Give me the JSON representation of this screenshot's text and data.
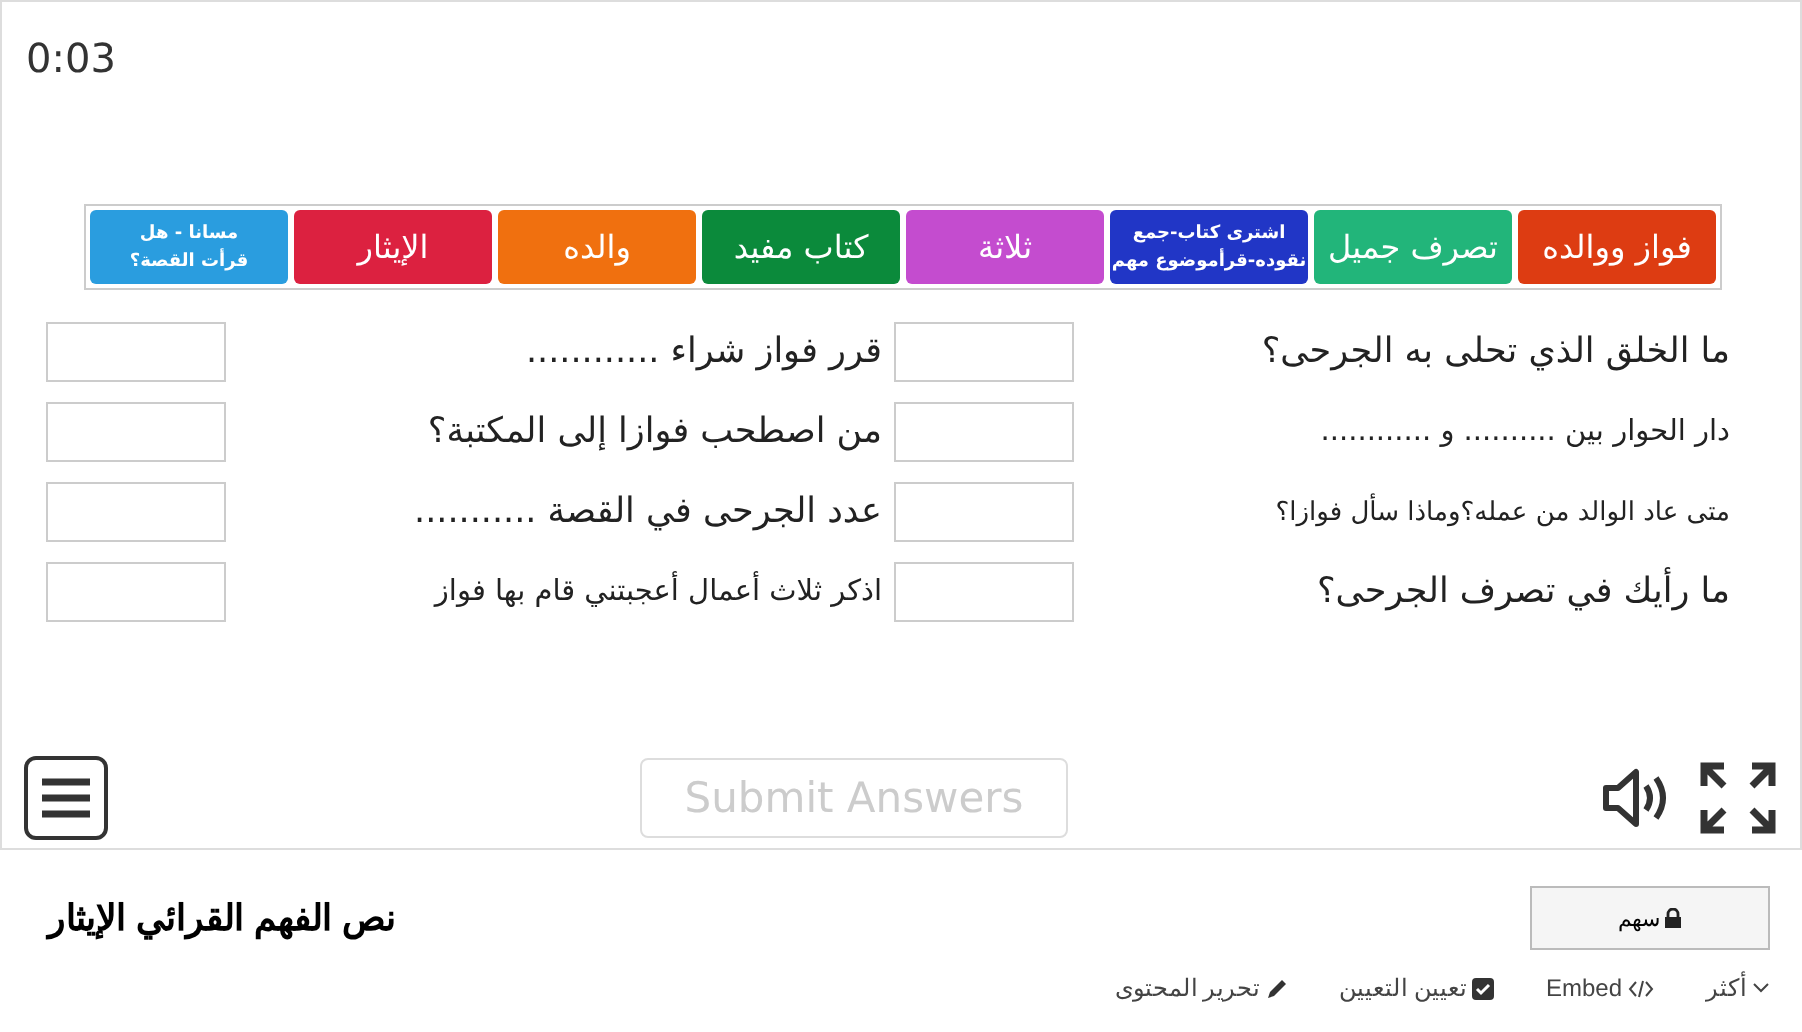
{
  "timer": "0:03",
  "tiles": [
    {
      "lines": [
        "فواز ووالده"
      ],
      "color": "#dd3c12"
    },
    {
      "lines": [
        "تصرف جميل"
      ],
      "color": "#22b57a"
    },
    {
      "lines": [
        "اشترى كتاب-جمع",
        "نقوده-قرأموضوع مهم"
      ],
      "color": "#2136c6"
    },
    {
      "lines": [
        "ثلاثة"
      ],
      "color": "#c44ccf"
    },
    {
      "lines": [
        "كتاب مفيد"
      ],
      "color": "#0b8a3b"
    },
    {
      "lines": [
        "والده"
      ],
      "color": "#f0700f"
    },
    {
      "lines": [
        "الإيثار"
      ],
      "color": "#dc2140"
    },
    {
      "lines": [
        "مسانا - هل",
        "قرأت القصة؟"
      ],
      "color": "#2a9ddf"
    }
  ],
  "questions": [
    {
      "prompt": "ما الخلق الذي تحلى به الجرحى؟",
      "kind": "large"
    },
    {
      "prompt": "قرر فواز شراء ............",
      "kind": "large"
    },
    {
      "prompt": "دار الحوار بين .......... و ............",
      "kind": "medium"
    },
    {
      "prompt": "من اصطحب فوازا إلى المكتبة؟",
      "kind": "large"
    },
    {
      "prompt": "متى عاد الوالد من عمله؟وماذا سأل فوازا؟",
      "kind": "small"
    },
    {
      "prompt": "عدد الجرحى في القصة ...........",
      "kind": "large"
    },
    {
      "prompt": "ما رأيك في تصرف الجرحى؟",
      "kind": "large"
    },
    {
      "prompt": "اذكر ثلاث أعمال أعجبتني قام بها فواز",
      "kind": "medium"
    }
  ],
  "submit": {
    "label": "Submit Answers",
    "disabled": true
  },
  "title": "نص الفهم القرائي الإيثار",
  "share": "سهم",
  "actions": [
    {
      "label": "أكثر",
      "kind": "more"
    },
    {
      "label": "Embed",
      "kind": "embed"
    },
    {
      "label": "تعيين التعيين",
      "kind": "assign"
    },
    {
      "label": "تحرير المحتوى",
      "kind": "edit"
    }
  ]
}
